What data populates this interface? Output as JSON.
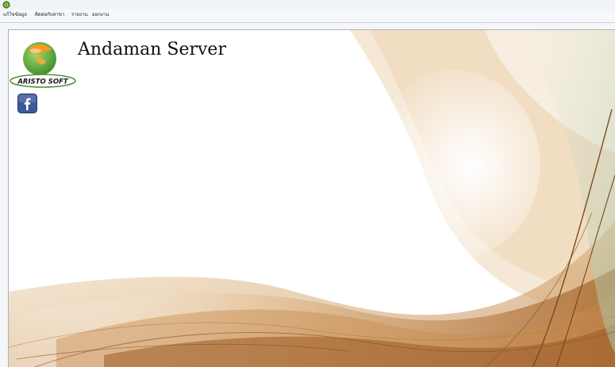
{
  "window": {
    "app_icon": "app-icon"
  },
  "menu": {
    "items": [
      {
        "label": "แก้ไขข้อมูล"
      },
      {
        "label": "ติดต่อกับสาขา"
      },
      {
        "label": "รายงาน"
      },
      {
        "label": "ออกงาน"
      }
    ]
  },
  "brand": {
    "logo_text": "ARISTO SOFT",
    "server_title": "Andaman Server",
    "facebook_icon": "facebook-icon"
  },
  "colors": {
    "accent_brown": "#8b4513",
    "accent_green": "#6aa63b",
    "facebook_blue": "#3b5998"
  }
}
